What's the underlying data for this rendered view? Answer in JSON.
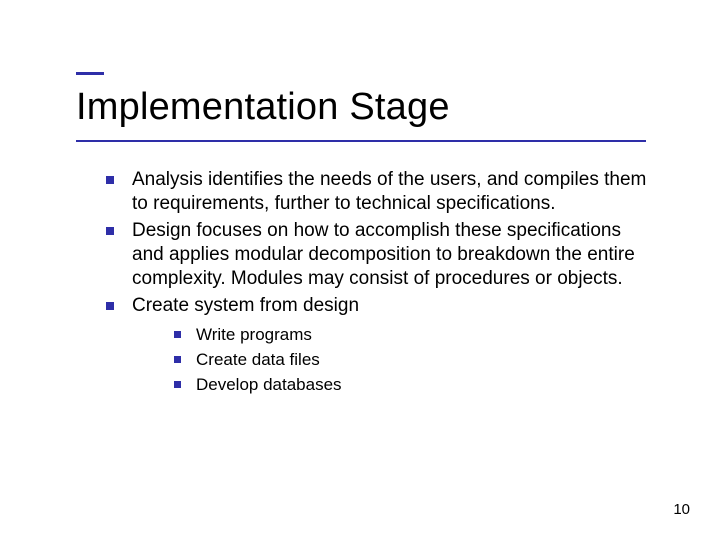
{
  "title": "Implementation Stage",
  "bullets": [
    {
      "text": "Analysis identifies the needs of the users, and compiles them to requirements, further to technical specifications."
    },
    {
      "text": "Design focuses on how to accomplish these specifications and applies modular decomposition to breakdown the entire complexity. Modules may consist of procedures or objects."
    },
    {
      "text": "Create system from design"
    }
  ],
  "sub_bullets": [
    {
      "text": "Write programs"
    },
    {
      "text": "Create data files"
    },
    {
      "text": "Develop databases"
    }
  ],
  "page_number": "10",
  "accent_color": "#2e2ea8"
}
